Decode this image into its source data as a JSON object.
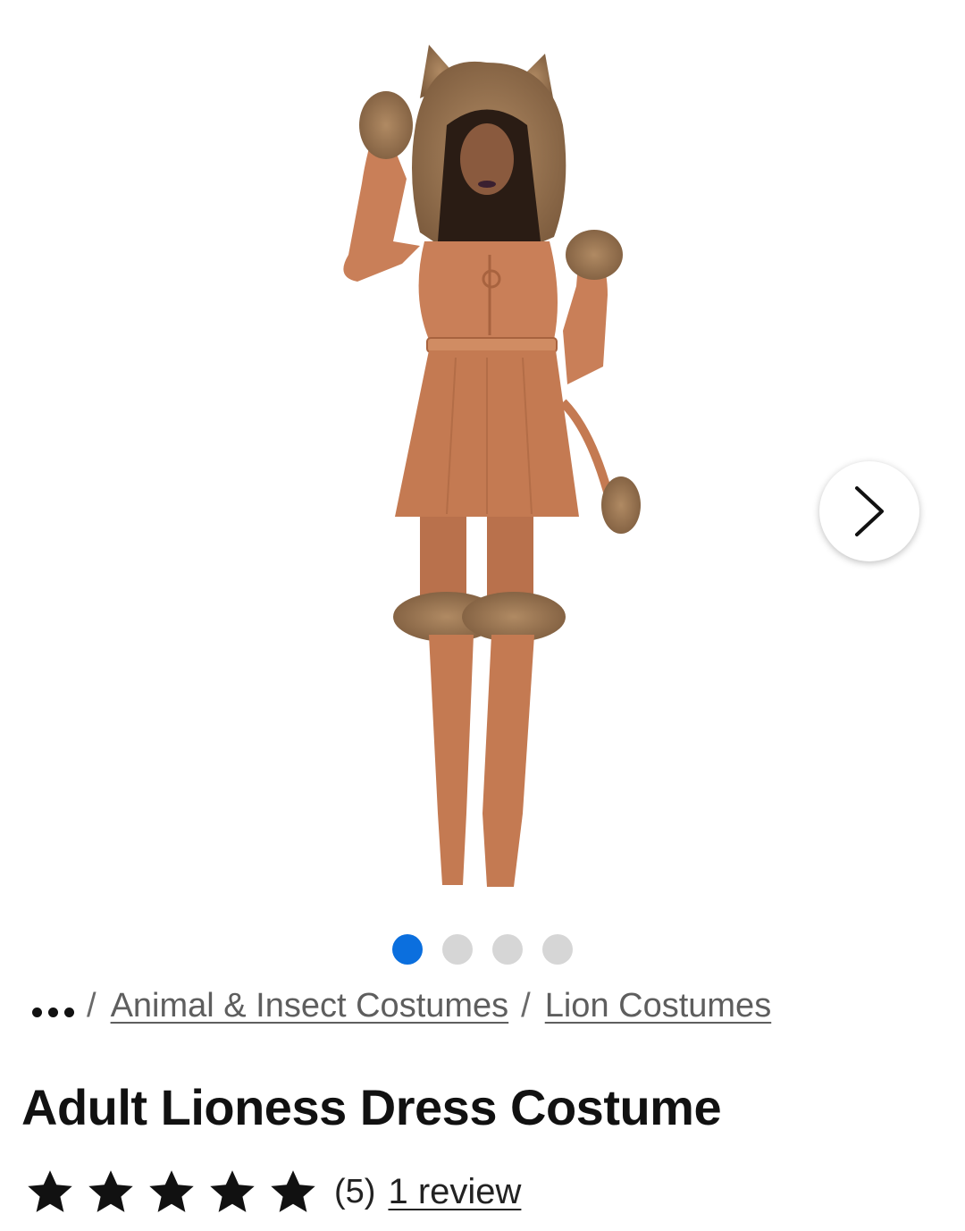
{
  "gallery": {
    "image_alt": "Adult Lioness Dress Costume",
    "next_icon": "chevron-right-icon",
    "slides_total": 4,
    "active_slide": 1
  },
  "breadcrumb": {
    "more_icon": "more-dots-icon",
    "separator": "/",
    "items": [
      {
        "label": "Animal & Insect Costumes"
      },
      {
        "label": "Lion Costumes"
      }
    ]
  },
  "product": {
    "title": "Adult Lioness Dress Costume",
    "rating": 5,
    "rating_max": 5,
    "rating_count_text": "(5)",
    "review_link_text": "1 review"
  },
  "colors": {
    "accent": "#0b6fde",
    "dot_inactive": "#d6d6d6",
    "costume": "#c97f58",
    "fur": "#9c7650"
  }
}
